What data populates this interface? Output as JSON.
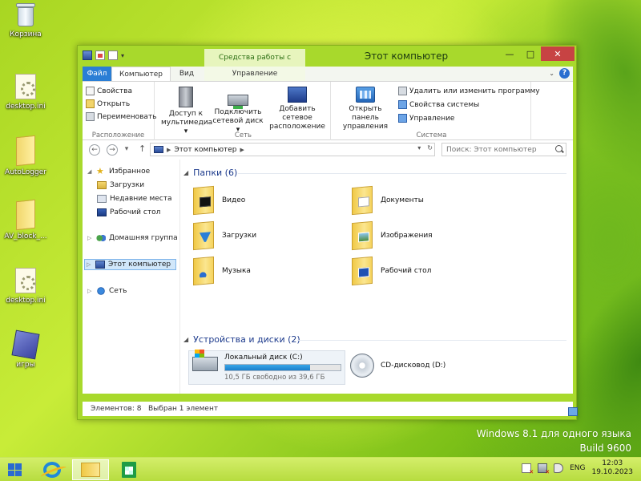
{
  "desktop": {
    "icons": [
      {
        "label": "Корзина"
      },
      {
        "label": "desktop.ini"
      },
      {
        "label": "AutoLogger"
      },
      {
        "label": "AV_block_..."
      },
      {
        "label": "desktop.ini"
      },
      {
        "label": "игры"
      }
    ],
    "watermark": {
      "line1": "Windows 8.1 для одного языка",
      "line2": "Build 9600"
    }
  },
  "window": {
    "title": "Этот компьютер",
    "context_tab": "Средства работы с дисками",
    "controls": {
      "minimize": "—",
      "maximize": "□",
      "close": "✕"
    },
    "tabs": {
      "file": "Файл",
      "computer": "Компьютер",
      "view": "Вид",
      "manage": "Управление"
    },
    "help": "?"
  },
  "ribbon": {
    "location": {
      "name": "Расположение",
      "properties": "Свойства",
      "open": "Открыть",
      "rename": "Переименовать"
    },
    "network": {
      "name": "Сеть",
      "media_access": {
        "line1": "Доступ к",
        "line2": "мультимедиа ▾"
      },
      "map_drive": {
        "line1": "Подключить",
        "line2": "сетевой диск ▾"
      },
      "add_location": {
        "line1": "Добавить сетевое",
        "line2": "расположение"
      }
    },
    "system": {
      "name": "Система",
      "control_panel": {
        "line1": "Открыть панель",
        "line2": "управления"
      },
      "uninstall": "Удалить или изменить программу",
      "sys_props": "Свойства системы",
      "manage": "Управление"
    }
  },
  "navbar": {
    "back": "←",
    "forward": "→",
    "up": "↑",
    "address": "Этот компьютер",
    "search_placeholder": "Поиск: Этот компьютер"
  },
  "navpane": {
    "favorites": "Избранное",
    "downloads": "Загрузки",
    "recent": "Недавние места",
    "desktop": "Рабочий стол",
    "homegroup": "Домашняя группа",
    "this_pc": "Этот компьютер",
    "network": "Сеть"
  },
  "content": {
    "folders_header": "Папки (6)",
    "folders": [
      "Видео",
      "Документы",
      "Загрузки",
      "Изображения",
      "Музыка",
      "Рабочий стол"
    ],
    "devices_header": "Устройства и диски (2)",
    "drive_c": {
      "name": "Локальный диск (C:)",
      "free_text": "10,5 ГБ свободно из 39,6 ГБ",
      "used_fraction": 0.735
    },
    "drive_d": {
      "name": "CD-дисковод (D:)"
    }
  },
  "status": {
    "items": "Элементов: 8",
    "selected": "Выбран 1 элемент"
  },
  "taskbar": {
    "lang": "ENG",
    "time": "12:03",
    "date": "19.10.2023"
  },
  "colors": {
    "accent": "#2a7ed5",
    "window_frame": "#a8d92c",
    "progress": "#1c7fcc"
  }
}
